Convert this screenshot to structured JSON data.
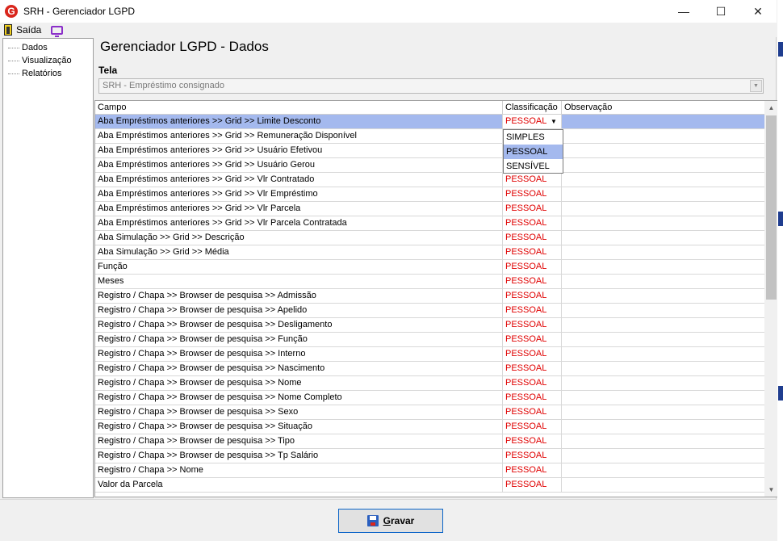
{
  "window": {
    "title": "SRH - Gerenciador LGPD",
    "icon_letter": "G",
    "minimize": "—",
    "maximize": "☐",
    "close": "✕"
  },
  "menu": {
    "exit_label": "Saída"
  },
  "sidebar": {
    "items": [
      "Dados",
      "Visualização",
      "Relatórios"
    ]
  },
  "main": {
    "title": "Gerenciador LGPD - Dados",
    "tela_label": "Tela",
    "tela_value": "SRH - Empréstimo consignado"
  },
  "grid": {
    "headers": {
      "campo": "Campo",
      "classificacao": "Classificação",
      "observacao": "Observação"
    },
    "rows": [
      {
        "campo": "Aba Empréstimos anteriores >> Grid >> Limite Desconto",
        "cls": "PESSOAL"
      },
      {
        "campo": "Aba Empréstimos anteriores >> Grid >> Remuneração Disponível",
        "cls": ""
      },
      {
        "campo": "Aba Empréstimos anteriores >> Grid >> Usuário Efetivou",
        "cls": ""
      },
      {
        "campo": "Aba Empréstimos anteriores >> Grid >> Usuário Gerou",
        "cls": ""
      },
      {
        "campo": "Aba Empréstimos anteriores >> Grid >> Vlr Contratado",
        "cls": "PESSOAL"
      },
      {
        "campo": "Aba Empréstimos anteriores >> Grid >> Vlr Empréstimo",
        "cls": "PESSOAL"
      },
      {
        "campo": "Aba Empréstimos anteriores >> Grid >> Vlr Parcela",
        "cls": "PESSOAL"
      },
      {
        "campo": "Aba Empréstimos anteriores >> Grid >> Vlr Parcela Contratada",
        "cls": "PESSOAL"
      },
      {
        "campo": "Aba Simulação >> Grid >> Descrição",
        "cls": "PESSOAL"
      },
      {
        "campo": "Aba Simulação >> Grid >> Média",
        "cls": "PESSOAL"
      },
      {
        "campo": "Função",
        "cls": "PESSOAL"
      },
      {
        "campo": "Meses",
        "cls": "PESSOAL"
      },
      {
        "campo": "Registro / Chapa >> Browser de pesquisa >> Admissão",
        "cls": "PESSOAL"
      },
      {
        "campo": "Registro / Chapa >> Browser de pesquisa >> Apelido",
        "cls": "PESSOAL"
      },
      {
        "campo": "Registro / Chapa >> Browser de pesquisa >> Desligamento",
        "cls": "PESSOAL"
      },
      {
        "campo": "Registro / Chapa >> Browser de pesquisa >> Função",
        "cls": "PESSOAL"
      },
      {
        "campo": "Registro / Chapa >> Browser de pesquisa >> Interno",
        "cls": "PESSOAL"
      },
      {
        "campo": "Registro / Chapa >> Browser de pesquisa >> Nascimento",
        "cls": "PESSOAL"
      },
      {
        "campo": "Registro / Chapa >> Browser de pesquisa >> Nome",
        "cls": "PESSOAL"
      },
      {
        "campo": "Registro / Chapa >> Browser de pesquisa >> Nome Completo",
        "cls": "PESSOAL"
      },
      {
        "campo": "Registro / Chapa >> Browser de pesquisa >> Sexo",
        "cls": "PESSOAL"
      },
      {
        "campo": "Registro / Chapa >> Browser de pesquisa >> Situação",
        "cls": "PESSOAL"
      },
      {
        "campo": "Registro / Chapa >> Browser de pesquisa >> Tipo",
        "cls": "PESSOAL"
      },
      {
        "campo": "Registro / Chapa >> Browser de pesquisa >> Tp Salário",
        "cls": "PESSOAL"
      },
      {
        "campo": "Registro / Chapa >> Nome",
        "cls": "PESSOAL"
      },
      {
        "campo": "Valor da Parcela",
        "cls": "PESSOAL"
      }
    ],
    "dropdown_options": [
      "SIMPLES",
      "PESSOAL",
      "SENSÍVEL"
    ],
    "dropdown_selected": "PESSOAL"
  },
  "footer": {
    "save_first_letter": "G",
    "save_rest": "ravar"
  },
  "colors": {
    "selection": "#a4b9ee",
    "classification_text": "#e00000",
    "button_border": "#0a64c8"
  }
}
